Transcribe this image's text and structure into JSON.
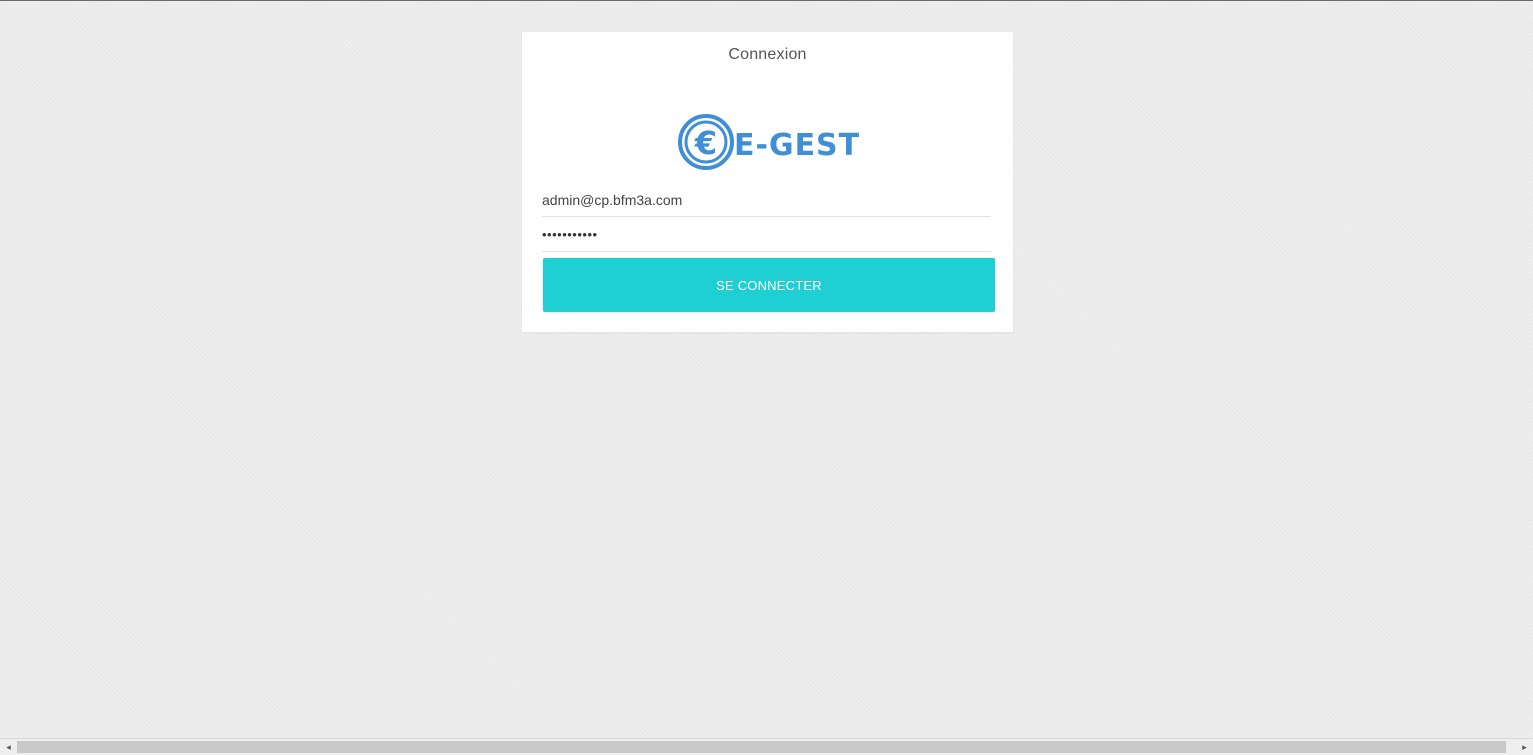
{
  "login": {
    "title": "Connexion",
    "logo_text": "E-GEST",
    "logo_symbol": "€",
    "email_value": "admin@cp.bfm3a.com",
    "password_value": "•••••••••••",
    "submit_label": "SE CONNECTER"
  },
  "colors": {
    "accent": "#1ecfd4",
    "logo_blue": "#3e8fd6",
    "background": "#e9e9e9"
  },
  "scrollbar": {
    "left_arrow": "◂",
    "right_arrow": "▸"
  }
}
